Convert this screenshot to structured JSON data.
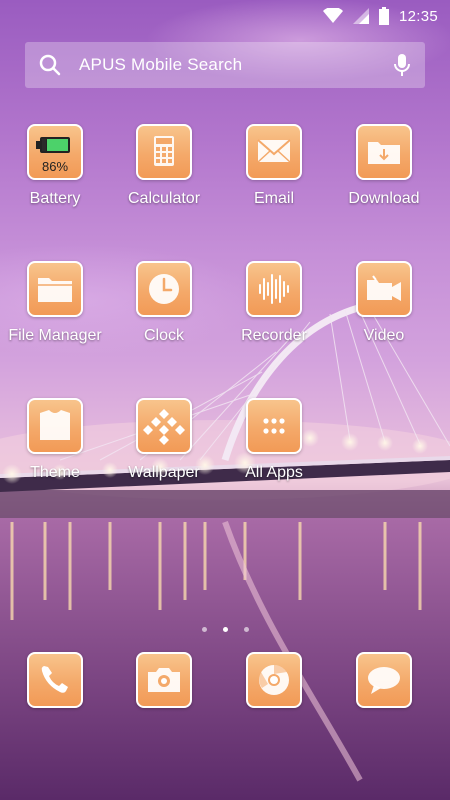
{
  "status_bar": {
    "time": "12:35",
    "icons": [
      "wifi-icon",
      "cell-signal-icon",
      "battery-icon"
    ]
  },
  "search": {
    "placeholder": "APUS Mobile Search",
    "icons": [
      "search-icon",
      "mic-icon"
    ]
  },
  "apps": [
    {
      "label": "Battery",
      "icon": "battery-icon",
      "badge": "86%"
    },
    {
      "label": "Calculator",
      "icon": "calculator-icon"
    },
    {
      "label": "Email",
      "icon": "envelope-icon"
    },
    {
      "label": "Download",
      "icon": "download-folder-icon"
    },
    {
      "label": "File Manager",
      "icon": "folder-icon"
    },
    {
      "label": "Clock",
      "icon": "clock-icon"
    },
    {
      "label": "Recorder",
      "icon": "waveform-icon"
    },
    {
      "label": "Video",
      "icon": "video-camera-icon"
    },
    {
      "label": "Theme",
      "icon": "shirt-icon"
    },
    {
      "label": "Wallpaper",
      "icon": "wallpaper-diamond-icon"
    },
    {
      "label": "All Apps",
      "icon": "app-grid-icon"
    }
  ],
  "page_indicator": {
    "pages": 3,
    "current": 2
  },
  "dock": [
    {
      "icon": "phone-icon"
    },
    {
      "icon": "camera-icon"
    },
    {
      "icon": "browser-icon"
    },
    {
      "icon": "message-bubble-icon"
    }
  ],
  "colors": {
    "icon_tile": "#f4a96a",
    "icon_border": "#ffffff",
    "battery_level": "#4cd26a"
  }
}
